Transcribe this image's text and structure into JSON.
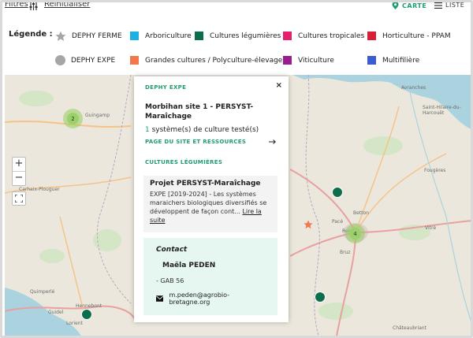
{
  "toolbar": {
    "filtres": "Filtres",
    "reinitialiser": "Réinitialiser",
    "carte": "CARTE",
    "liste": "LISTE"
  },
  "legend": {
    "title": "Légende :",
    "items": [
      {
        "label": "DEPHY FERME",
        "shape": "star",
        "color": "#a6a6a6"
      },
      {
        "label": "Arboriculture",
        "shape": "square",
        "color": "#1fb0e3"
      },
      {
        "label": "Cultures légumières",
        "shape": "square",
        "color": "#0d6e4c"
      },
      {
        "label": "Cultures tropicales",
        "shape": "square",
        "color": "#e3206e"
      },
      {
        "label": "Horticulture - PPAM",
        "shape": "square",
        "color": "#d91f35"
      },
      {
        "label": "DEPHY EXPE",
        "shape": "circle",
        "color": "#a6a6a6"
      },
      {
        "label": "Grandes cultures / Polyculture-élevage",
        "shape": "square",
        "color": "#f2774a"
      },
      {
        "label": "Viticulture",
        "shape": "square",
        "color": "#9a1d8e"
      },
      {
        "label": "Multifilière",
        "shape": "square",
        "color": "#3a5bd1"
      }
    ]
  },
  "map": {
    "labels": [
      "Avranches",
      "Saint-Hilaire-du-Harcouët",
      "Guingamp",
      "Carhaix-Plouguer",
      "Fougères",
      "Betton",
      "Pacé",
      "Rennes",
      "Vitré",
      "Bruz",
      "Quimperlé",
      "Hennebont",
      "Lorient",
      "Guidel",
      "Châteaubriant"
    ],
    "clusters": [
      {
        "count": "2"
      },
      {
        "count": "4"
      }
    ],
    "zoom_in": "+",
    "zoom_out": "−"
  },
  "popup": {
    "kind": "DEPHY EXPE",
    "title": "Morbihan site 1 - PERSYST-Maraîchage",
    "count_num": "1",
    "count_text": " système(s) de culture testé(s)",
    "link": "PAGE DU SITE ET RESSOURCES",
    "section": "CULTURES LÉGUMIÈRES",
    "project_title": "Projet PERSYST-Maraîchage",
    "project_desc": "EXPE [2019-2024] - Les systèmes maraichers biologiques diversifiés se développent de façon cont... ",
    "project_more": "Lire la suite",
    "contact_title": "Contact",
    "contact_name": "Maëla PEDEN",
    "contact_org": "- GAB 56",
    "contact_email": "m.peden@agrobio-bretagne.org",
    "close": "×"
  }
}
